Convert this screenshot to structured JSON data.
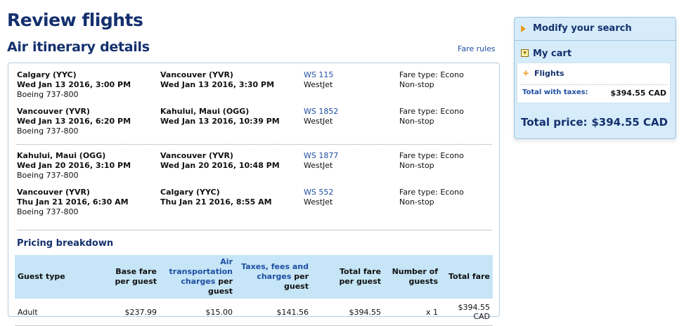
{
  "page": {
    "title": "Review flights",
    "subtitle": "Air itinerary details",
    "fare_rules": "Fare rules"
  },
  "segments": [
    {
      "from": "Calgary (YYC)",
      "depart": "Wed Jan 13 2016, 3:00 PM",
      "aircraft": "Boeing 737-800",
      "to": "Vancouver (YVR)",
      "arrive": "Wed Jan 13 2016, 3:30 PM",
      "flight": "WS 115",
      "airline": "WestJet",
      "fare_type": "Fare type: Econo",
      "stops": "Non-stop"
    },
    {
      "from": "Vancouver (YVR)",
      "depart": "Wed Jan 13 2016, 6:20 PM",
      "aircraft": "Boeing 737-800",
      "to": "Kahului, Maui (OGG)",
      "arrive": "Wed Jan 13 2016, 10:39 PM",
      "flight": "WS 1852",
      "airline": "WestJet",
      "fare_type": "Fare type: Econo",
      "stops": "Non-stop"
    },
    {
      "from": "Kahului, Maui (OGG)",
      "depart": "Wed Jan 20 2016, 3:10 PM",
      "aircraft": "Boeing 737-800",
      "to": "Vancouver (YVR)",
      "arrive": "Wed Jan 20 2016, 10:48 PM",
      "flight": "WS 1877",
      "airline": "WestJet",
      "fare_type": "Fare type: Econo",
      "stops": "Non-stop"
    },
    {
      "from": "Vancouver (YVR)",
      "depart": "Thu Jan 21 2016, 6:30 AM",
      "aircraft": "Boeing 737-800",
      "to": "Calgary (YYC)",
      "arrive": "Thu Jan 21 2016, 8:55 AM",
      "flight": "WS 552",
      "airline": "WestJet",
      "fare_type": "Fare type: Econo",
      "stops": "Non-stop"
    }
  ],
  "pricing": {
    "title": "Pricing breakdown",
    "headers": {
      "guest_type": "Guest type",
      "base_fare_1": "Base fare",
      "base_fare_2": "per guest",
      "air_transport_link": "Air transportation charges",
      "air_transport_suffix": " per guest",
      "taxes_link": "Taxes, fees and charges",
      "taxes_suffix": " per guest",
      "total_fare_1": "Total fare",
      "total_fare_2": "per guest",
      "num_guests_1": "Number of",
      "num_guests_2": "guests",
      "total_fare": "Total fare"
    },
    "rows": [
      {
        "guest_type": "Adult",
        "base_fare": "$237.99",
        "air_transport": "$15.00",
        "taxes": "$141.56",
        "total_per_guest": "$394.55",
        "num_guests": "x 1",
        "total": "$394.55 CAD"
      }
    ]
  },
  "sidebar": {
    "modify_search": "Modify your search",
    "my_cart": "My cart",
    "flights": "Flights",
    "total_with_taxes_label": "Total with taxes:",
    "total_with_taxes_value": "$394.55 CAD",
    "total_price_label": "Total price:",
    "total_price_value": "$394.55 CAD"
  },
  "colors": {
    "heading": "#14306e",
    "link": "#1f4fa3",
    "header_bg": "#c6e5f7",
    "sidebar_bg": "#d6ecfa",
    "accent": "#e79c1c"
  }
}
